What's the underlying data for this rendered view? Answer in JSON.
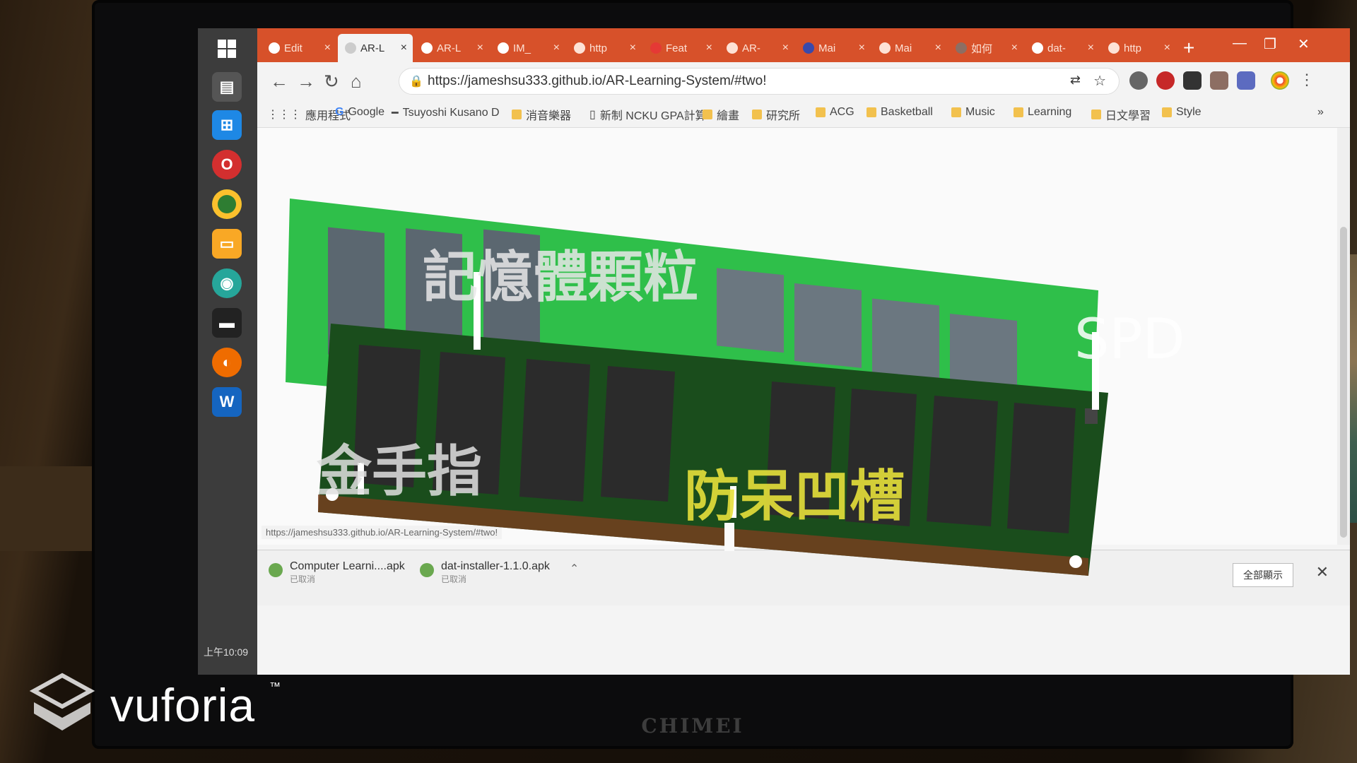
{
  "monitor": {
    "brand": "CHIMEI"
  },
  "browser": {
    "tabs": [
      {
        "label": "Edit",
        "active": false
      },
      {
        "label": "AR-L",
        "active": true
      },
      {
        "label": "AR-L",
        "active": false
      },
      {
        "label": "IM_",
        "active": false
      },
      {
        "label": "http",
        "active": false
      },
      {
        "label": "Feat",
        "active": false
      },
      {
        "label": "AR-",
        "active": false
      },
      {
        "label": "Mai",
        "active": false
      },
      {
        "label": "Mai",
        "active": false
      },
      {
        "label": "如何",
        "active": false
      },
      {
        "label": "dat-",
        "active": false
      },
      {
        "label": "http",
        "active": false
      }
    ],
    "url": "https://jameshsu333.github.io/AR-Learning-System/#two!",
    "bookmarks": [
      "應用程式",
      "Google",
      "Tsuyoshi Kusano D",
      "消音樂器",
      "新制 NCKU GPA計算",
      "繪畫",
      "研究所",
      "ACG",
      "Basketball",
      "Music",
      "Learning",
      "日文學習",
      "Style"
    ],
    "more_bookmarks": "»",
    "status_url": "https://jameshsu333.github.io/AR-Learning-System/#two!",
    "downloads": [
      {
        "name": "Computer Learni....apk",
        "status": "已取消"
      },
      {
        "name": "dat-installer-1.1.0.apk",
        "status": "已取消"
      }
    ],
    "show_all": "全部顯示"
  },
  "taskbar": {
    "clock": "上午10:09"
  },
  "ar_labels": {
    "memory_chips": "記憶體顆粒",
    "spd": "SPD",
    "gold_fingers": "金手指",
    "anti_notch": "防呆凹槽"
  },
  "vuforia": {
    "word": "vuforia",
    "tm": "™"
  }
}
